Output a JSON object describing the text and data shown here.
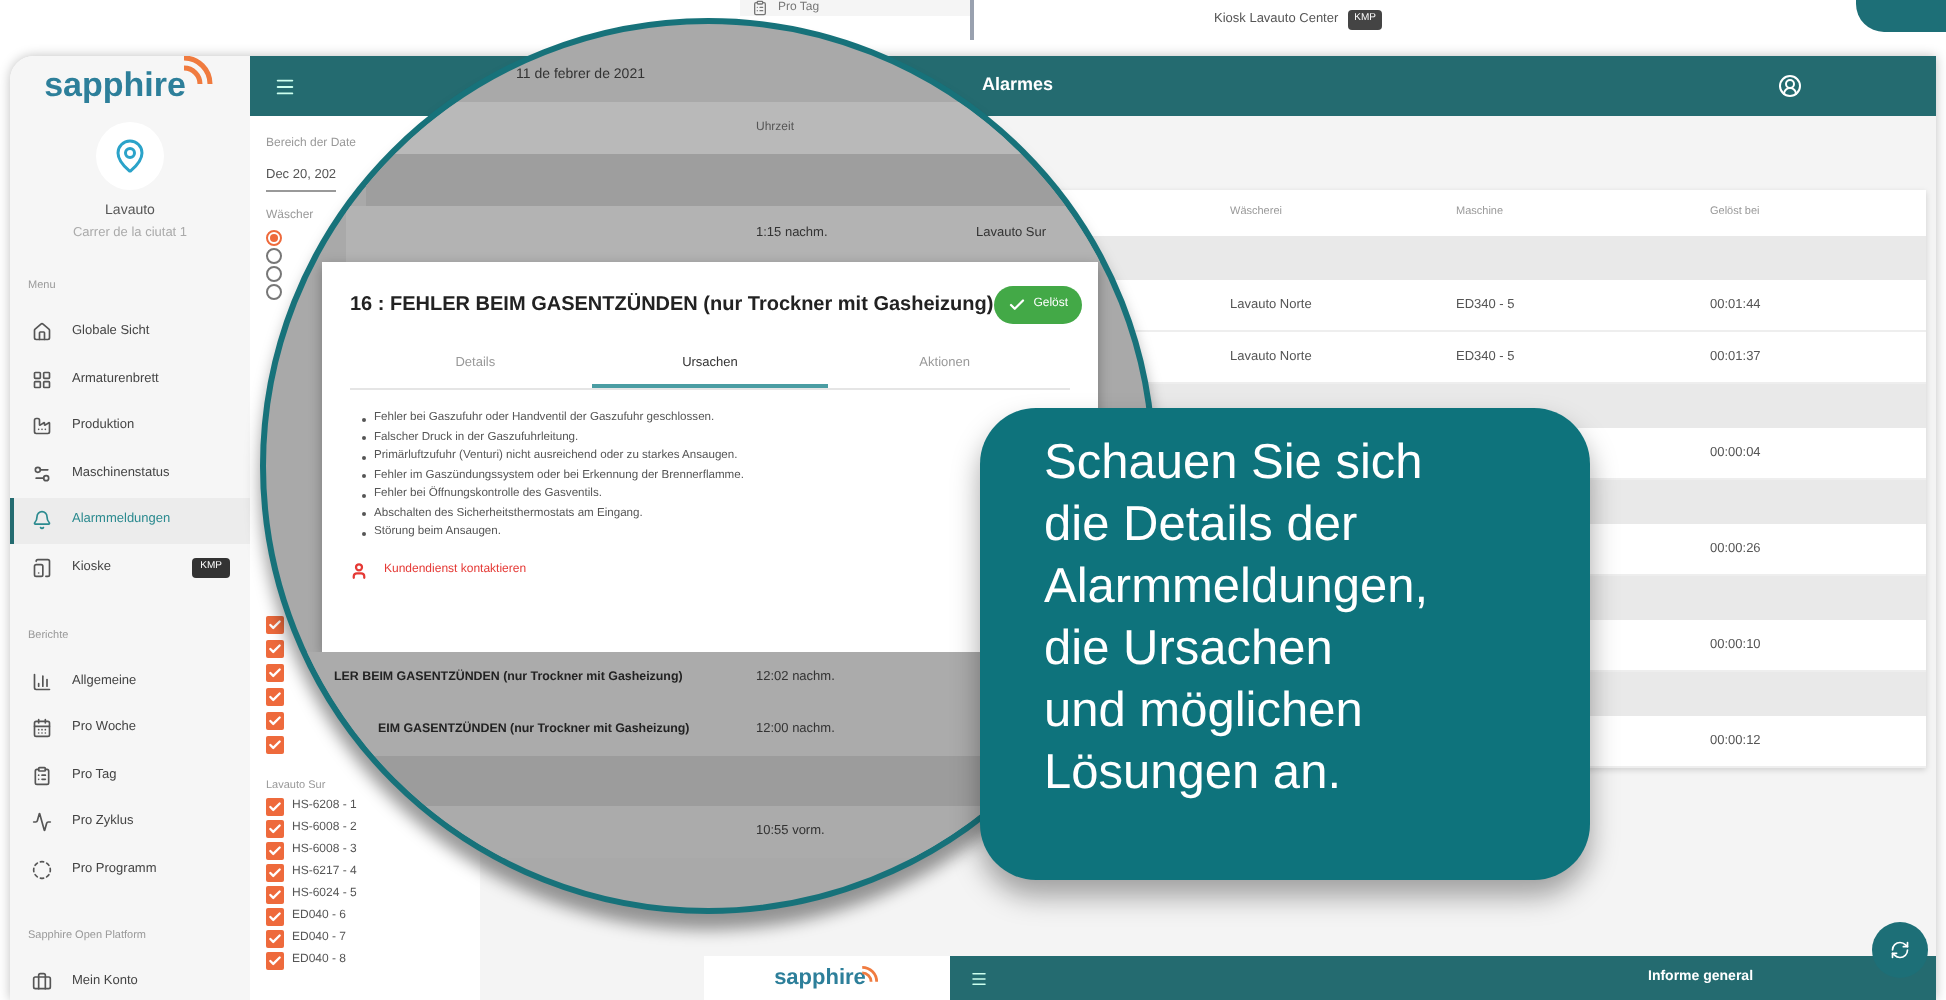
{
  "background_screens": {
    "top_sidebar_item": "Pro Tag",
    "top_kiosk": {
      "label": "Kiosk Lavauto Center",
      "badge": "KMP"
    },
    "bottom_app": {
      "brand": "sapphire",
      "title": "Informe general"
    }
  },
  "sidebar": {
    "brand": "sapphire",
    "location": {
      "name": "Lavauto",
      "address": "Carrer de la ciutat 1"
    },
    "sections": [
      {
        "title": "Menu",
        "items": [
          {
            "label": "Globale Sicht",
            "selected": false
          },
          {
            "label": "Armaturenbrett",
            "selected": false
          },
          {
            "label": "Produktion",
            "selected": false
          },
          {
            "label": "Maschinenstatus",
            "selected": false
          },
          {
            "label": "Alarmmeldungen",
            "selected": true
          },
          {
            "label": "Kioske",
            "selected": false,
            "badge": "KMP"
          }
        ]
      },
      {
        "title": "Berichte",
        "items": [
          {
            "label": "Allgemeine",
            "selected": false
          },
          {
            "label": "Pro Woche",
            "selected": false
          },
          {
            "label": "Pro Tag",
            "selected": false
          },
          {
            "label": "Pro Zyklus",
            "selected": false
          },
          {
            "label": "Pro Programm",
            "selected": false
          }
        ]
      },
      {
        "title": "Sapphire Open Platform",
        "items": [
          {
            "label": "Mein Konto",
            "selected": false
          }
        ]
      }
    ]
  },
  "header": {
    "title": "Alarmes"
  },
  "filters": {
    "range_label": "Bereich der Date",
    "range_value": "Dec 20, 202",
    "laundry_label": "Wäscher",
    "radios": [
      {
        "selected": true
      },
      {
        "selected": false
      },
      {
        "selected": false
      },
      {
        "selected": false
      }
    ],
    "covered_checks": [
      {
        "checked": true
      },
      {
        "checked": true
      },
      {
        "checked": true
      },
      {
        "checked": true
      },
      {
        "checked": true
      },
      {
        "checked": true
      }
    ],
    "group_label": "Lavauto Sur",
    "machines": [
      {
        "label": "HS-6208 - 1",
        "checked": true
      },
      {
        "label": "HS-6008 - 2",
        "checked": true
      },
      {
        "label": "HS-6008 - 3",
        "checked": true
      },
      {
        "label": "HS-6217 - 4",
        "checked": true
      },
      {
        "label": "HS-6024 - 5",
        "checked": true
      },
      {
        "label": "ED040 - 6",
        "checked": true
      },
      {
        "label": "ED040 - 7",
        "checked": true
      },
      {
        "label": "ED040 - 8",
        "checked": true
      }
    ]
  },
  "table": {
    "columns": [
      "Wäscherei",
      "Maschine",
      "Gelöst bei"
    ],
    "rows": [
      {
        "kind": "group"
      },
      {
        "kind": "row",
        "laundry": "Lavauto Norte",
        "machine": "ED340 - 5",
        "resolved_at": "00:01:44"
      },
      {
        "kind": "row",
        "laundry": "Lavauto Norte",
        "machine": "ED340 - 5",
        "resolved_at": "00:01:37"
      },
      {
        "kind": "group"
      },
      {
        "kind": "row",
        "resolved_at": "00:00:04"
      },
      {
        "kind": "group"
      },
      {
        "kind": "row",
        "resolved_at": "00:00:26"
      },
      {
        "kind": "group"
      },
      {
        "kind": "row",
        "resolved_at": "00:00:10"
      },
      {
        "kind": "group"
      },
      {
        "kind": "row",
        "resolved_at": "00:00:12"
      }
    ]
  },
  "magnifier": {
    "date": "11 de febrer de 2021",
    "time_column": "Uhrzeit",
    "top_row": {
      "time": "1:15 nachm.",
      "laundry": "Lavauto Sur"
    },
    "modal": {
      "title": "16 : FEHLER BEIM GASENTZÜNDEN (nur Trockner mit Gasheizung)",
      "status": "Gelöst",
      "tabs": [
        {
          "label": "Details",
          "selected": false
        },
        {
          "label": "Ursachen",
          "selected": true
        },
        {
          "label": "Aktionen",
          "selected": false
        }
      ],
      "causes": [
        "Fehler bei Gaszufuhr oder Handventil der Gaszufuhr geschlossen.",
        "Falscher Druck in der Gaszufuhrleitung.",
        "Primärluftzufuhr (Venturi) nicht ausreichend oder zu starkes Ansaugen.",
        "Fehler im Gaszündungssystem oder bei Erkennung der Brennerflamme.",
        "Fehler bei Öffnungskontrolle des Gasventils.",
        "Abschalten des Sicherheitsthermostats am Eingang.",
        "Störung beim Ansaugen."
      ],
      "contact_link": "Kundendienst kontaktieren"
    },
    "rows": [
      {
        "kind": "row",
        "alarm": "LER BEIM GASENTZÜNDEN (nur Trockner mit Gasheizung)",
        "time": "12:02 nachm."
      },
      {
        "kind": "row",
        "alarm": "EIM GASENTZÜNDEN (nur Trockner mit Gasheizung)",
        "time": "12:00 nachm."
      },
      {
        "kind": "group"
      },
      {
        "kind": "row",
        "time": "10:55 vorm."
      }
    ]
  },
  "callout": {
    "text": "Schauen Sie sich\ndie Details der\nAlarmmeldungen,\ndie Ursachen\nund möglichen\nLösungen an."
  }
}
